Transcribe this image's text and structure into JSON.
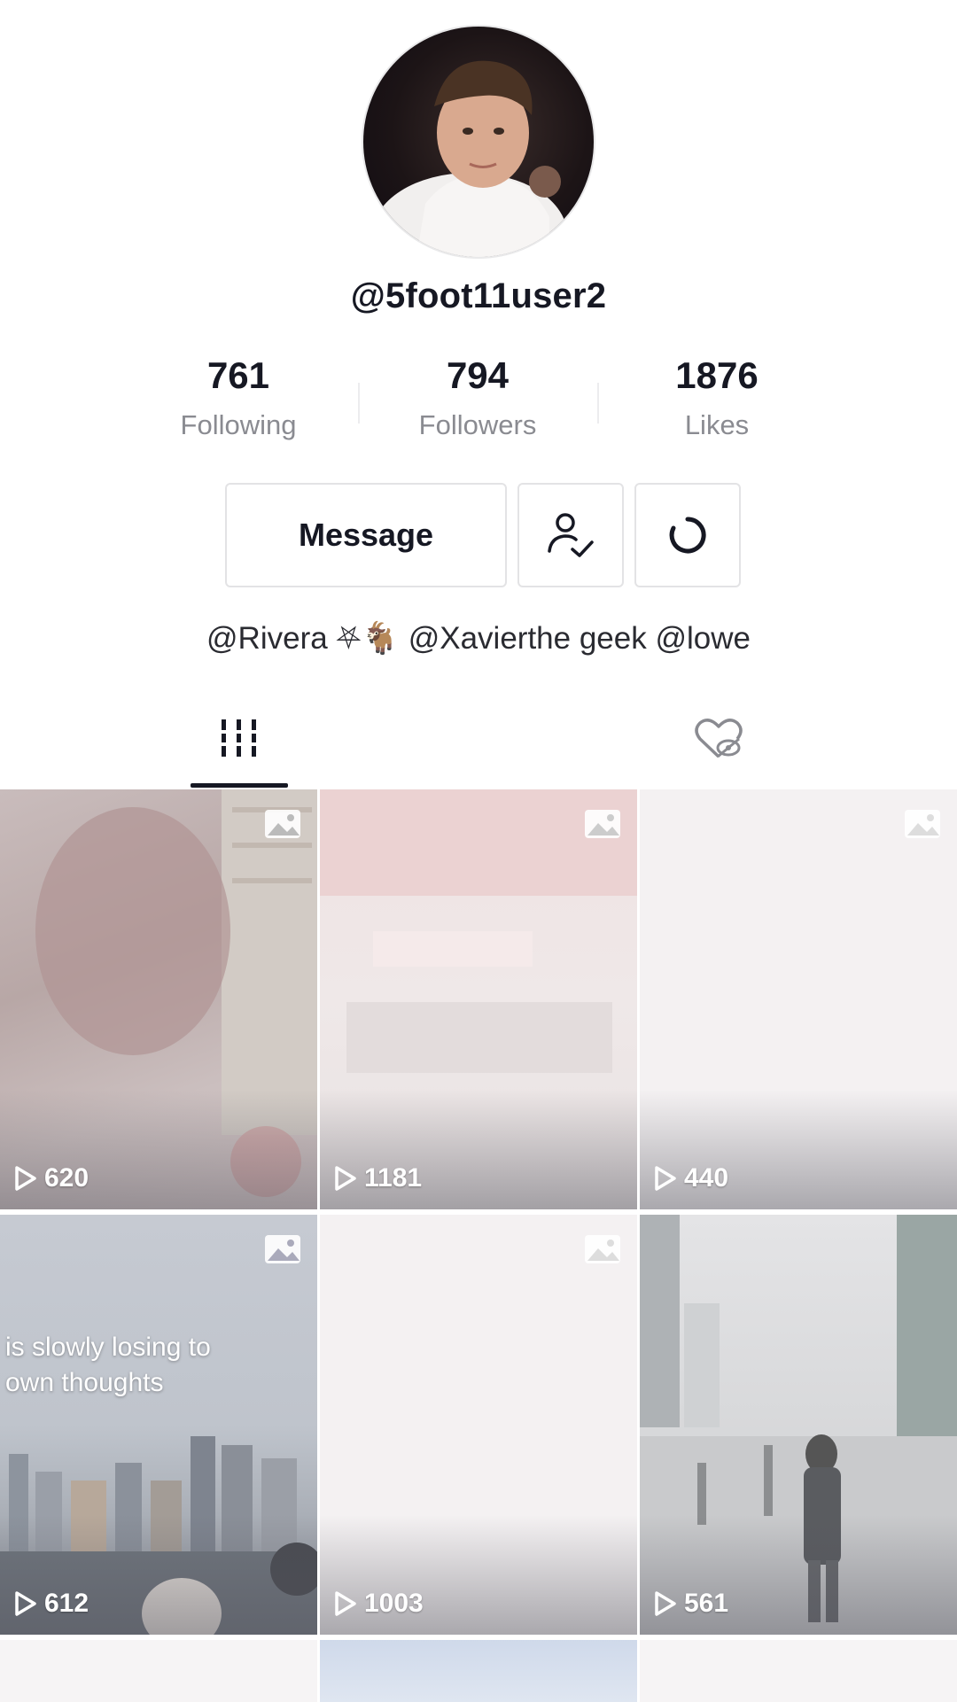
{
  "profile": {
    "username": "@5foot11user2",
    "bio": "@Rivera ⛧🐐 @Xavierthe geek @lowe"
  },
  "stats": [
    {
      "value": "761",
      "label": "Following"
    },
    {
      "value": "794",
      "label": "Followers"
    },
    {
      "value": "1876",
      "label": "Likes"
    }
  ],
  "actions": {
    "message_label": "Message",
    "friend_icon": "user-check-icon",
    "refresh_icon": "refresh-icon"
  },
  "tabs": [
    {
      "icon": "videos-grid-icon",
      "selected": true
    },
    {
      "icon": "liked-hidden-icon",
      "selected": false
    }
  ],
  "videos": [
    {
      "views": "620",
      "photo": true,
      "caption": ""
    },
    {
      "views": "1181",
      "photo": true,
      "caption": ""
    },
    {
      "views": "440",
      "photo": true,
      "caption": ""
    },
    {
      "views": "612",
      "photo": true,
      "caption": "is slowly losing to\nown thoughts"
    },
    {
      "views": "1003",
      "photo": true,
      "caption": ""
    },
    {
      "views": "561",
      "photo": false,
      "caption": ""
    }
  ],
  "colors": {
    "text_primary": "#161823",
    "text_secondary": "#8a8b91",
    "border": "#e3e3e5"
  }
}
